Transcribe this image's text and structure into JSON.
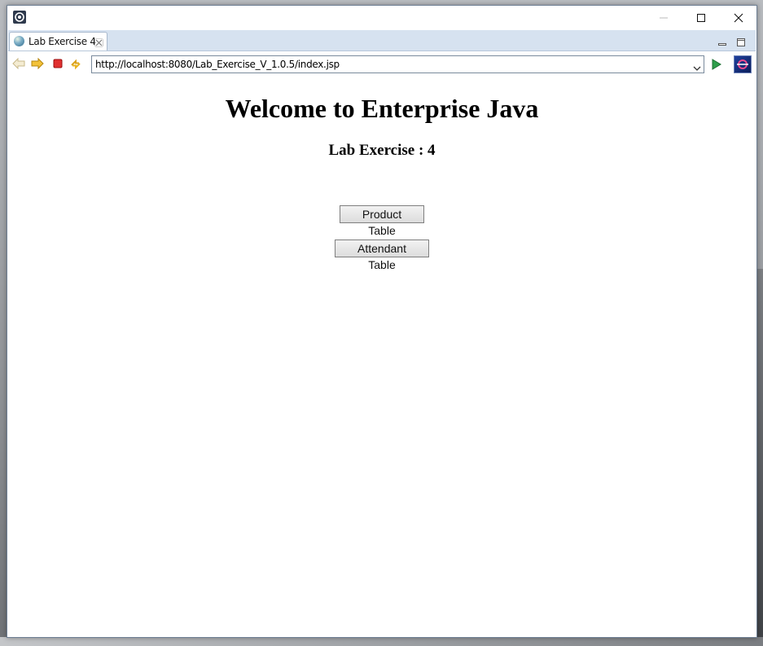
{
  "window": {
    "tab_label": "Lab Exercise 4"
  },
  "toolbar": {
    "url": "http://localhost:8080/Lab_Exercise_V_1.0.5/index.jsp"
  },
  "page": {
    "title": "Welcome to Enterprise Java",
    "subtitle": "Lab Exercise : 4",
    "buttons": [
      {
        "label": "Product Table"
      },
      {
        "label": "Attendant Table"
      }
    ]
  },
  "icons": {
    "app": "eclipse-app-icon",
    "tab": "globe-icon",
    "back": "back-arrow-icon",
    "forward": "forward-arrow-icon",
    "stop": "stop-icon",
    "refresh": "refresh-icon",
    "go": "go-arrow-icon"
  },
  "colors": {
    "tabbar": "#d6e2f0",
    "stop": "#e03030",
    "go": "#2e9e4a",
    "nav_arrow": "#e8b320"
  }
}
